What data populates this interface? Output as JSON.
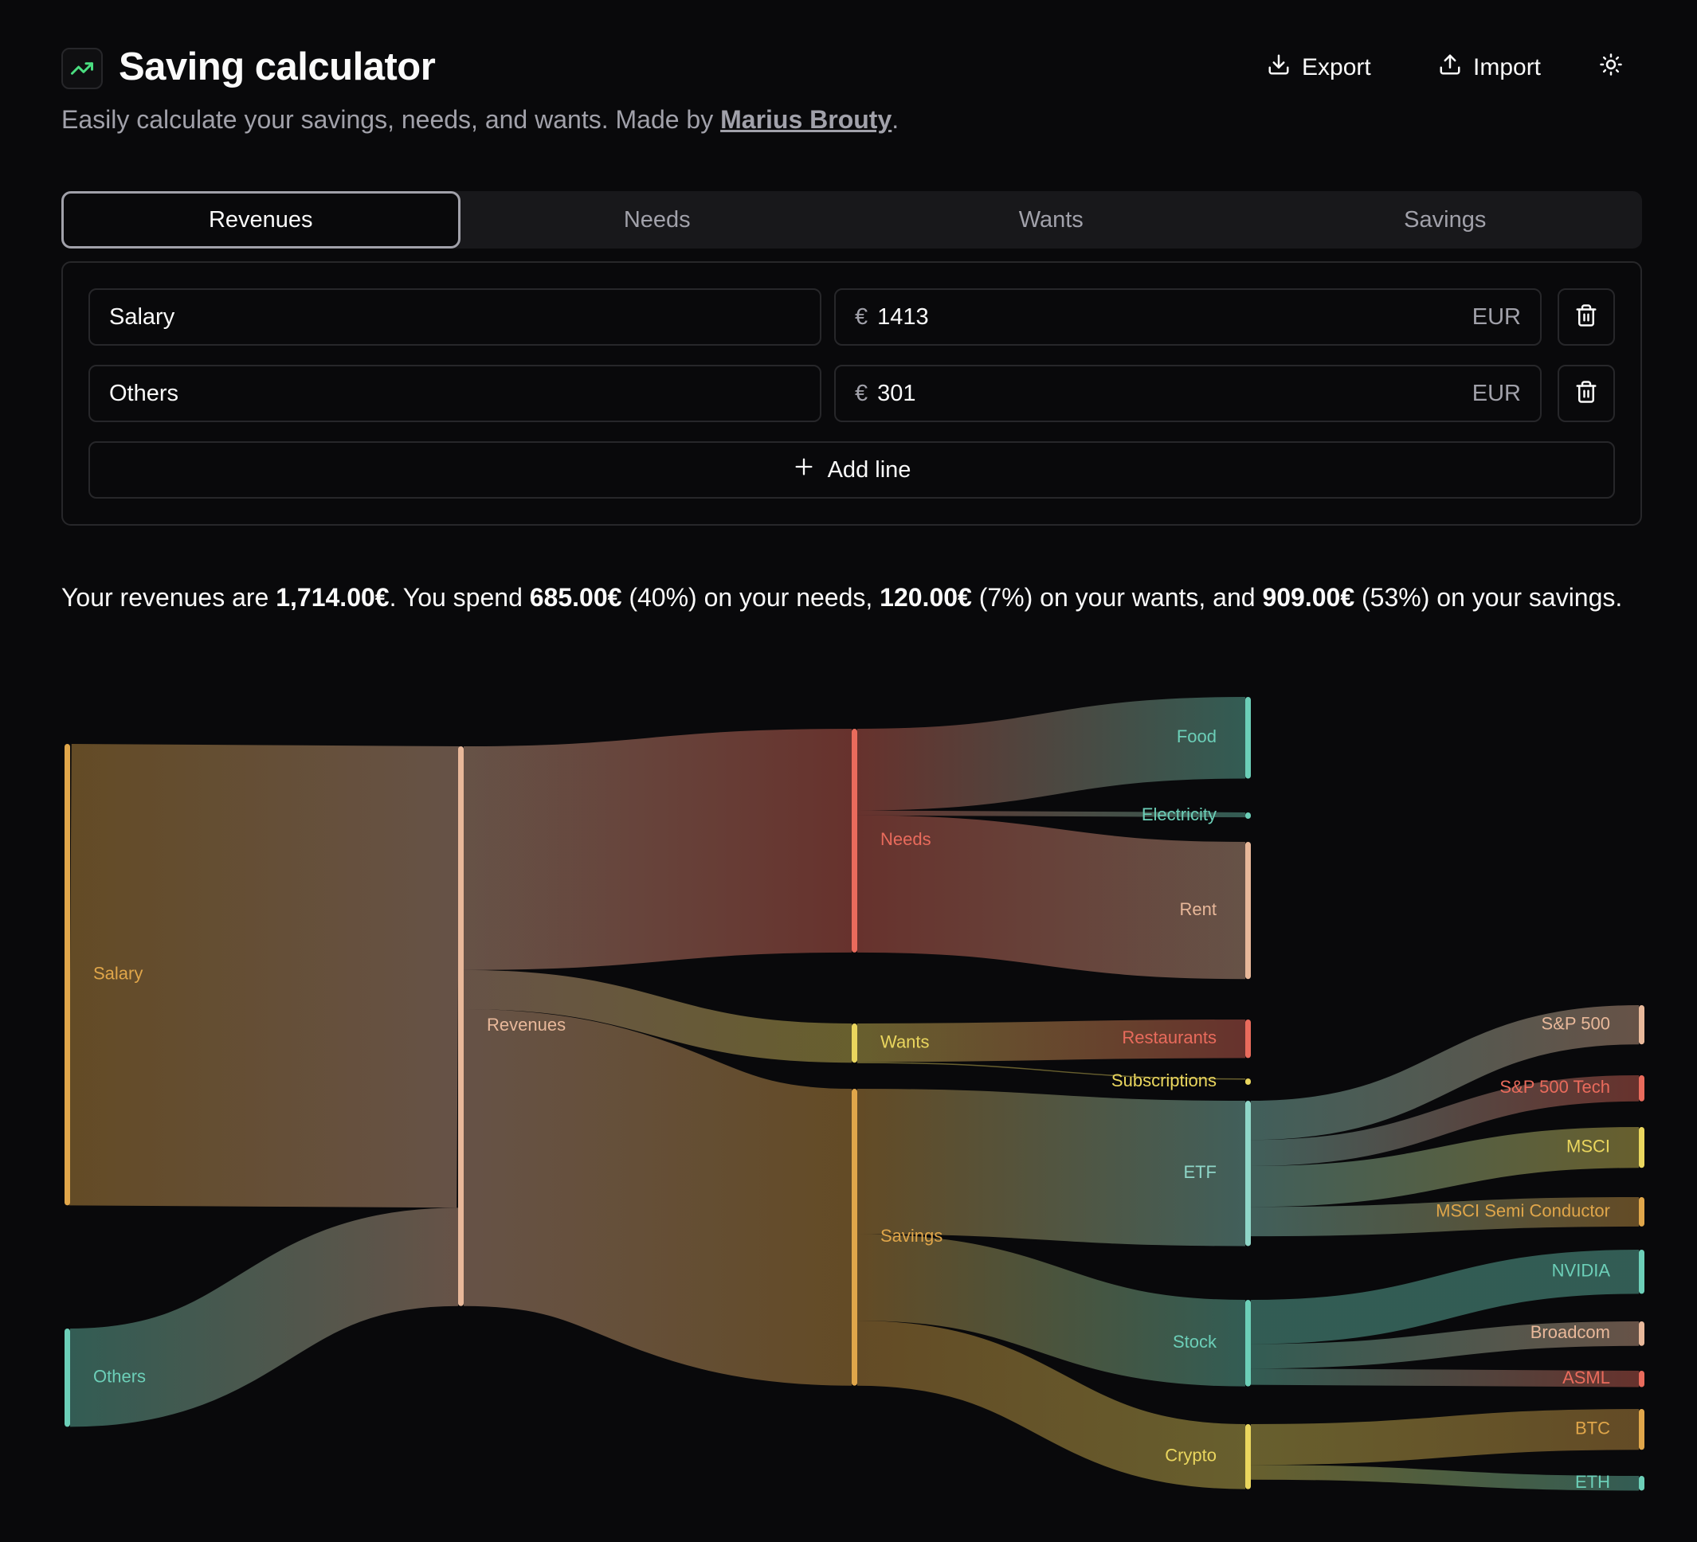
{
  "header": {
    "title": "Saving calculator",
    "export_label": "Export",
    "import_label": "Import"
  },
  "subtitle": {
    "text": "Easily calculate your savings, needs, and wants. Made by ",
    "author": "Marius Brouty",
    "end": "."
  },
  "tabs": [
    {
      "label": "Revenues",
      "active": true
    },
    {
      "label": "Needs",
      "active": false
    },
    {
      "label": "Wants",
      "active": false
    },
    {
      "label": "Savings",
      "active": false
    }
  ],
  "lines": [
    {
      "name": "Salary",
      "currency_symbol": "€",
      "amount": "1413",
      "currency": "EUR"
    },
    {
      "name": "Others",
      "currency_symbol": "€",
      "amount": "301",
      "currency": "EUR"
    }
  ],
  "add_line_label": "Add line",
  "summary": {
    "p1": "Your revenues are ",
    "revenues": "1,714.00€",
    "p2": ". You spend ",
    "needs": "685.00€",
    "p3": " (40%) on your needs, ",
    "wants": "120.00€",
    "p4": " (7%) on your wants, and ",
    "savings": "909.00€",
    "p5": " (53%) on your savings."
  },
  "colors": {
    "orange": "#e0a64a",
    "teal": "#6ccfb8",
    "peach": "#e8b89a",
    "red": "#e96b5c",
    "yellow": "#ead65e",
    "accent_green": "#4ade80"
  },
  "chart_data": {
    "type": "sankey",
    "nodes": [
      {
        "id": "Salary",
        "color": "#e0a64a"
      },
      {
        "id": "Others",
        "color": "#6ccfb8"
      },
      {
        "id": "Revenues",
        "color": "#e8b89a"
      },
      {
        "id": "Needs",
        "color": "#e96b5c"
      },
      {
        "id": "Wants",
        "color": "#ead65e"
      },
      {
        "id": "Savings",
        "color": "#e0a64a"
      },
      {
        "id": "Food",
        "color": "#6ccfb8"
      },
      {
        "id": "Electricity",
        "color": "#6ccfb8"
      },
      {
        "id": "Rent",
        "color": "#e8b89a"
      },
      {
        "id": "Restaurants",
        "color": "#e96b5c"
      },
      {
        "id": "Subscriptions",
        "color": "#ead65e"
      },
      {
        "id": "ETF",
        "color": "#8fd6c8"
      },
      {
        "id": "Stock",
        "color": "#6ccfb8"
      },
      {
        "id": "Crypto",
        "color": "#ead65e"
      },
      {
        "id": "S&P 500",
        "color": "#e8b89a"
      },
      {
        "id": "S&P 500 Tech",
        "color": "#e96b5c"
      },
      {
        "id": "MSCI",
        "color": "#ead65e"
      },
      {
        "id": "MSCI Semi Conductor",
        "color": "#e0a64a"
      },
      {
        "id": "NVIDIA",
        "color": "#6ccfb8"
      },
      {
        "id": "Broadcom",
        "color": "#e8b89a"
      },
      {
        "id": "ASML",
        "color": "#e96b5c"
      },
      {
        "id": "BTC",
        "color": "#e0a64a"
      },
      {
        "id": "ETH",
        "color": "#6ccfb8"
      }
    ],
    "links": [
      {
        "source": "Salary",
        "target": "Revenues",
        "value": 1413
      },
      {
        "source": "Others",
        "target": "Revenues",
        "value": 301
      },
      {
        "source": "Revenues",
        "target": "Needs",
        "value": 685
      },
      {
        "source": "Revenues",
        "target": "Wants",
        "value": 120
      },
      {
        "source": "Revenues",
        "target": "Savings",
        "value": 909
      },
      {
        "source": "Needs",
        "target": "Food",
        "value": 250
      },
      {
        "source": "Needs",
        "target": "Electricity",
        "value": 15
      },
      {
        "source": "Needs",
        "target": "Rent",
        "value": 420
      },
      {
        "source": "Wants",
        "target": "Restaurants",
        "value": 118
      },
      {
        "source": "Wants",
        "target": "Subscriptions",
        "value": 2
      },
      {
        "source": "Savings",
        "target": "ETF",
        "value": 445
      },
      {
        "source": "Savings",
        "target": "Stock",
        "value": 265
      },
      {
        "source": "Savings",
        "target": "Crypto",
        "value": 199
      },
      {
        "source": "ETF",
        "target": "S&P 500",
        "value": 120
      },
      {
        "source": "ETF",
        "target": "S&P 500 Tech",
        "value": 80
      },
      {
        "source": "ETF",
        "target": "MSCI",
        "value": 125
      },
      {
        "source": "ETF",
        "target": "MSCI Semi Conductor",
        "value": 90
      },
      {
        "source": "Stock",
        "target": "NVIDIA",
        "value": 135
      },
      {
        "source": "Stock",
        "target": "Broadcom",
        "value": 75
      },
      {
        "source": "Stock",
        "target": "ASML",
        "value": 50
      },
      {
        "source": "Crypto",
        "target": "BTC",
        "value": 125
      },
      {
        "source": "Crypto",
        "target": "ETH",
        "value": 45
      }
    ]
  }
}
